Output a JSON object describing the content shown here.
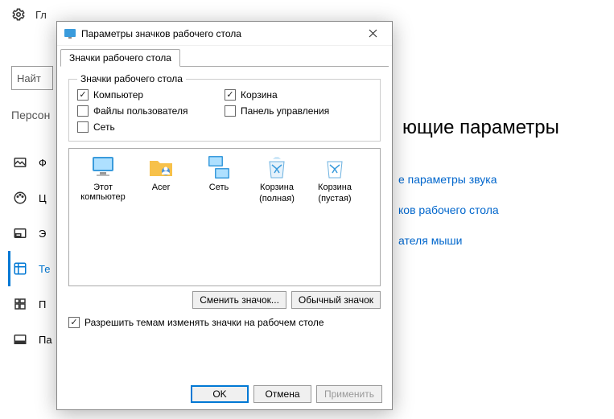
{
  "bg": {
    "gear_label": "Гл",
    "search_placeholder": "Найт",
    "category": "Персон",
    "items": [
      "Ф",
      "Ц",
      "Э",
      "Те",
      "П",
      "Па"
    ],
    "heading": "ющие параметры",
    "links": [
      "е параметры звука",
      "ков рабочего стола",
      "ателя мыши"
    ]
  },
  "dialog": {
    "title": "Параметры значков рабочего стола",
    "tab": "Значки рабочего стола",
    "group_legend": "Значки рабочего стола",
    "checks": {
      "computer": {
        "label": "Компьютер",
        "checked": true
      },
      "bin": {
        "label": "Корзина",
        "checked": true
      },
      "userfiles": {
        "label": "Файлы пользователя",
        "checked": false
      },
      "cpanel": {
        "label": "Панель управления",
        "checked": false
      },
      "network": {
        "label": "Сеть",
        "checked": false
      }
    },
    "icons": [
      {
        "name": "Этот компьютер",
        "sub": "",
        "key": "pc"
      },
      {
        "name": "Acer",
        "sub": "",
        "key": "user"
      },
      {
        "name": "Сеть",
        "sub": "",
        "key": "net"
      },
      {
        "name": "Корзина",
        "sub": "(полная)",
        "key": "binfull"
      },
      {
        "name": "Корзина",
        "sub": "(пустая)",
        "key": "binempty"
      }
    ],
    "change_btn": "Сменить значок...",
    "default_btn": "Обычный значок",
    "allow_themes": {
      "label": "Разрешить темам изменять значки на рабочем столе",
      "checked": true
    },
    "ok": "OK",
    "cancel": "Отмена",
    "apply": "Применить"
  }
}
